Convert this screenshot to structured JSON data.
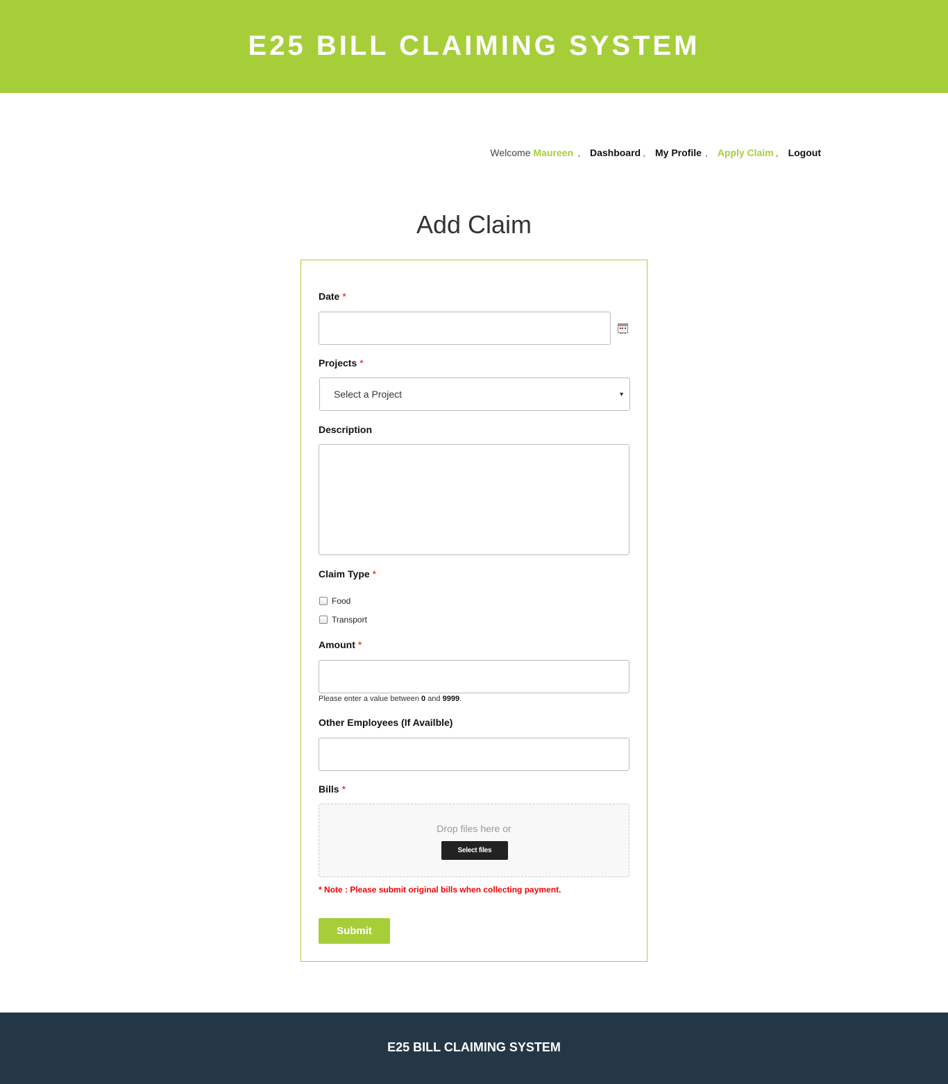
{
  "header": {
    "title": "E25 BILL CLAIMING SYSTEM"
  },
  "nav": {
    "welcome": "Welcome",
    "username": "Maureen",
    "separator": ",",
    "dashboard": "Dashboard",
    "profile": "My Profile",
    "apply_claim": "Apply Claim",
    "logout": "Logout"
  },
  "page": {
    "title": "Add Claim"
  },
  "form": {
    "required_mark": "*",
    "date": {
      "label": "Date",
      "value": ""
    },
    "projects": {
      "label": "Projects",
      "selected": "Select a Project"
    },
    "description": {
      "label": "Description",
      "value": ""
    },
    "claim_type": {
      "label": "Claim Type",
      "options": [
        {
          "label": "Food",
          "checked": false
        },
        {
          "label": "Transport",
          "checked": false
        }
      ]
    },
    "amount": {
      "label": "Amount",
      "value": "",
      "hint_prefix": "Please enter a value between",
      "hint_min": "0",
      "hint_and": "and",
      "hint_max": "9999",
      "hint_end": "."
    },
    "other_employees": {
      "label": "Other Employees (If Availble)",
      "value": ""
    },
    "bills": {
      "label": "Bills",
      "drop_text": "Drop files here or",
      "select_button": "Select files"
    },
    "note": "* Note : Please submit original bills when collecting payment.",
    "submit_label": "Submit"
  },
  "footer": {
    "title": "E25 BILL CLAIMING SYSTEM"
  },
  "colors": {
    "accent": "#a6ce39",
    "footer_bg": "#243746",
    "required": "#ee0000"
  }
}
